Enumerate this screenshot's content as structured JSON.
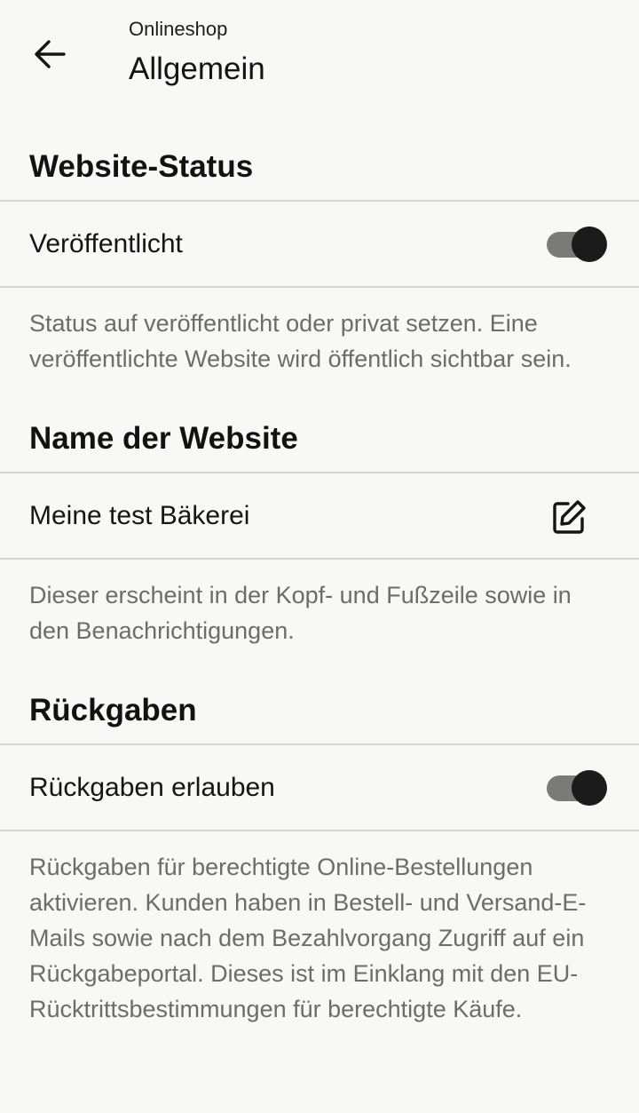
{
  "header": {
    "subtitle": "Onlineshop",
    "title": "Allgemein"
  },
  "sections": {
    "status": {
      "title": "Website-Status",
      "row_label": "Veröffentlicht",
      "toggle_on": true,
      "description": "Status auf veröffentlicht oder privat setzen. Eine veröffentlichte Website wird öffentlich sichtbar sein."
    },
    "name": {
      "title": "Name der Website",
      "row_value": "Meine test Bäkerei",
      "description": "Dieser erscheint in der Kopf- und Fußzeile sowie in den Benachrichtigungen."
    },
    "returns": {
      "title": "Rückgaben",
      "row_label": "Rückgaben erlauben",
      "toggle_on": true,
      "description": "Rückgaben für berechtigte Online-Bestellungen aktivieren. Kunden haben in Bestell- und Versand-E-Mails sowie nach dem Bezahlvorgang Zugriff auf ein Rückgabeportal. Dieses ist im Einklang mit den EU-Rücktrittsbestimmungen für berechtigte Käufe."
    }
  },
  "icons": {
    "back": "arrow-left-icon",
    "edit": "edit-icon"
  },
  "colors": {
    "background": "#f8f8f6",
    "divider": "#d6d6d4",
    "description_text": "#6e6c69",
    "toggle_track": "#7a7a78",
    "toggle_knob": "#1b1b1b"
  }
}
